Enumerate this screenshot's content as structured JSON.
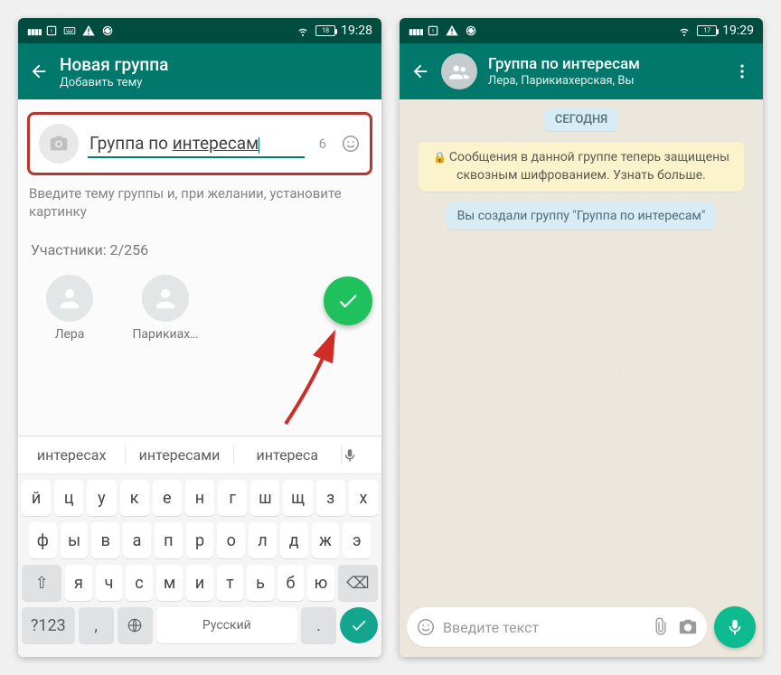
{
  "left": {
    "status": {
      "battery": "18",
      "time": "19:28"
    },
    "toolbar": {
      "title": "Новая группа",
      "subtitle": "Добавить тему"
    },
    "input": {
      "group_name_before": "Группа по ",
      "group_name_underline": "интересам",
      "char_left": "6"
    },
    "hint": "Введите тему группы и, при желании, установите картинку",
    "participants_label": "Участники: 2/256",
    "participants": [
      {
        "name": "Лера"
      },
      {
        "name": "Парикиах…"
      }
    ],
    "suggestions": [
      "интересах",
      "интересами",
      "интереса"
    ],
    "keyboard": {
      "row1": [
        "й",
        "ц",
        "у",
        "к",
        "е",
        "н",
        "г",
        "ш",
        "щ",
        "з",
        "х"
      ],
      "row2": [
        "ф",
        "ы",
        "в",
        "а",
        "п",
        "р",
        "о",
        "л",
        "д",
        "ж",
        "э"
      ],
      "row3_shift": "⇧",
      "row3": [
        "я",
        "ч",
        "с",
        "м",
        "и",
        "т",
        "ь",
        "б",
        "ю"
      ],
      "row3_back": "⌫",
      "row4_numeric": "?123",
      "row4_space": "Русский"
    }
  },
  "right": {
    "status": {
      "battery": "17",
      "time": "19:29"
    },
    "toolbar": {
      "title": "Группа по интересам",
      "subtitle": "Лера, Парикиахерская, Вы"
    },
    "date_label": "СЕГОДНЯ",
    "encryption_msg": "Сообщения в данной группе теперь защищены сквозным шифрованием. Узнать больше.",
    "created_msg": "Вы создали группу \"Группа по интересам\"",
    "input_placeholder": "Введите текст"
  }
}
